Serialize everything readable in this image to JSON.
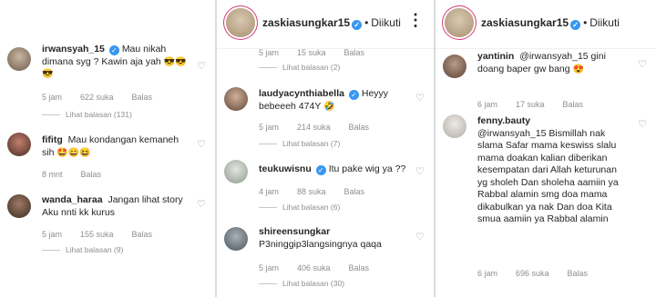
{
  "panel1": {
    "comments": [
      {
        "user": "irwansyah_15",
        "verified": true,
        "text": "Mau nikah dimana syg ? Kawin aja yah",
        "emoji": "😎😎😎",
        "time": "5 jam",
        "likes": "622 suka",
        "reply": "Balas",
        "view_replies": "Lihat balasan (131)"
      },
      {
        "user": "fifitg",
        "text": "Mau kondangan kemaneh sih",
        "emoji": "🤩😄😆",
        "time": "8 mnt",
        "reply": "Balas"
      },
      {
        "user": "wanda_haraa",
        "text": "Jangan lihat story Aku nnti kk kurus",
        "time": "5 jam",
        "likes": "155 suka",
        "reply": "Balas",
        "view_replies": "Lihat balasan (9)"
      }
    ]
  },
  "panel2": {
    "header": {
      "username": "zaskiasungkar15",
      "follow": "Diikuti"
    },
    "top": {
      "time": "5 jam",
      "likes": "15 suka",
      "reply": "Balas",
      "view_replies": "Lihat balasan (2)"
    },
    "comments": [
      {
        "user": "laudyacynthiabella",
        "verified": true,
        "text": "Heyyy bebeeeh 474Y",
        "emoji": "🤣",
        "time": "5 jam",
        "likes": "214 suka",
        "reply": "Balas",
        "view_replies": "Lihat balasan (7)"
      },
      {
        "user": "teukuwisnu",
        "verified": true,
        "text": "Itu pake wig ya ??",
        "time": "4 jam",
        "likes": "88 suka",
        "reply": "Balas",
        "view_replies": "Lihat balasan (6)"
      },
      {
        "user": "shireensungkar",
        "text": "P3ninggip3langsingnya qaqa",
        "time": "5 jam",
        "likes": "406 suka",
        "reply": "Balas",
        "view_replies": "Lihat balasan (30)"
      }
    ]
  },
  "panel3": {
    "header": {
      "username": "zaskiasungkar15",
      "follow": "Diikuti"
    },
    "comments": [
      {
        "user": "yantinin",
        "text": "@irwansyah_15 gini doang baper gw bang",
        "emoji": "😍",
        "time": "6 jam",
        "likes": "17 suka",
        "reply": "Balas"
      },
      {
        "user": "fenny.bauty",
        "text": "@irwansyah_15 Bismillah nak slama Safar mama keswiss slalu mama doakan kalian diberikan kesempatan dari Allah keturunan yg sholeh Dan sholeha aamiin ya Rabbal alamin smg doa mama dikabulkan ya nak Dan doa Kita smua aamiin ya Rabbal alamin",
        "time": "6 jam",
        "likes": "696 suka",
        "reply": "Balas"
      }
    ]
  },
  "colors": {
    "verified": "#3897f0",
    "muted": "#8e8e8e",
    "text": "#262626",
    "story_ring": "#d23a7a"
  }
}
